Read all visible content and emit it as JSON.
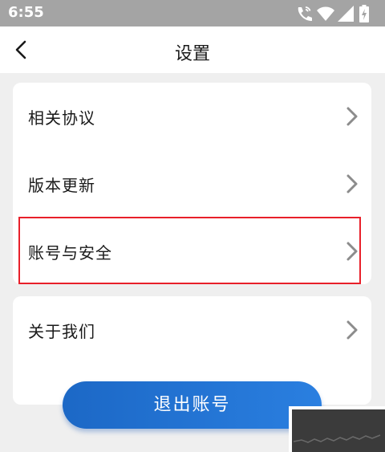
{
  "status_bar": {
    "time": "6:55",
    "icons": [
      "call-wifi-icon",
      "wifi-icon",
      "signal-icon",
      "battery-icon"
    ],
    "background": "#a4a4a4"
  },
  "header": {
    "title": "设置",
    "back_icon": "chevron-left-icon"
  },
  "settings": {
    "group1": [
      {
        "label": "相关协议"
      },
      {
        "label": "版本更新"
      },
      {
        "label": "账号与安全",
        "highlighted": true
      }
    ],
    "group2": [
      {
        "label": "关于我们"
      }
    ]
  },
  "logout": {
    "label": "退出账号",
    "color": "#1c68c6"
  },
  "colors": {
    "highlight": "#e8202a",
    "chevron": "#8c8c8c"
  }
}
